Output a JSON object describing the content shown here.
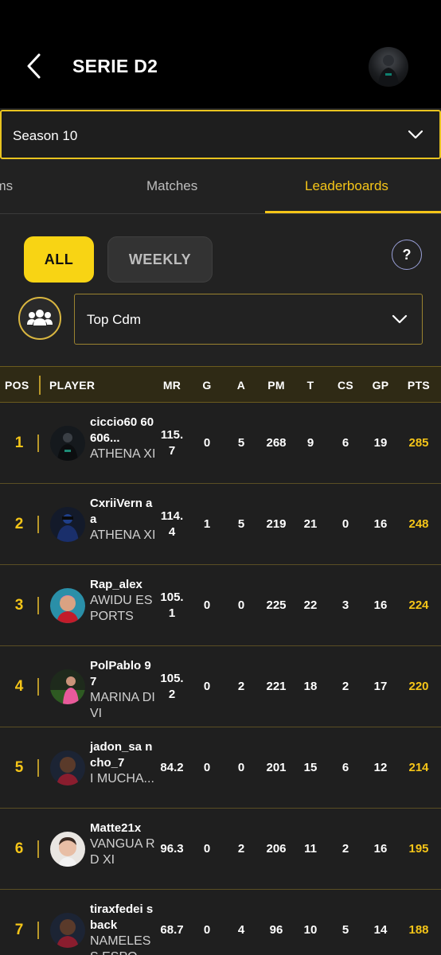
{
  "header": {
    "title": "SERIE D2"
  },
  "season": {
    "label": "Season 10"
  },
  "tabs": [
    {
      "label": "ams"
    },
    {
      "label": "Matches"
    },
    {
      "label": "Leaderboards"
    }
  ],
  "period": {
    "all": "ALL",
    "weekly": "WEEKLY",
    "help": "?"
  },
  "filter": {
    "label": "Top Cdm"
  },
  "table": {
    "headers": {
      "pos": "POS",
      "player": "PLAYER",
      "mr": "MR",
      "g": "G",
      "a": "A",
      "pm": "PM",
      "t": "T",
      "cs": "CS",
      "gp": "GP",
      "pts": "PTS"
    },
    "rows": [
      {
        "pos": "1",
        "name": "ciccio60 60606...",
        "team": "ATHENA XI",
        "mr": "115. 7",
        "g": "0",
        "a": "5",
        "pm": "268",
        "t": "9",
        "cs": "6",
        "gp": "19",
        "pts": "285",
        "avatar": "dark-player"
      },
      {
        "pos": "2",
        "name": "CxriiVern aa",
        "team": "ATHENA XI",
        "mr": "114. 4",
        "g": "1",
        "a": "5",
        "pm": "219",
        "t": "21",
        "cs": "0",
        "gp": "16",
        "pts": "248",
        "avatar": "blue-player"
      },
      {
        "pos": "3",
        "name": "Rap_alex",
        "team": "AWIDU ESPORTS",
        "mr": "105. 1",
        "g": "0",
        "a": "0",
        "pm": "225",
        "t": "22",
        "cs": "3",
        "gp": "16",
        "pts": "224",
        "avatar": "face-player"
      },
      {
        "pos": "4",
        "name": "PolPablo 97",
        "team": "MARINA DIVI",
        "mr": "105. 2",
        "g": "0",
        "a": "2",
        "pm": "221",
        "t": "18",
        "cs": "2",
        "gp": "17",
        "pts": "220",
        "avatar": "pink-player"
      },
      {
        "pos": "5",
        "name": "jadon_sa ncho_7",
        "team": "I MUCHA...",
        "mr": "84.2",
        "g": "0",
        "a": "0",
        "pm": "201",
        "t": "15",
        "cs": "6",
        "gp": "12",
        "pts": "214",
        "avatar": "dark-face"
      },
      {
        "pos": "6",
        "name": "Matte21x",
        "team": "VANGUA RD XI",
        "mr": "96.3",
        "g": "0",
        "a": "2",
        "pm": "206",
        "t": "11",
        "cs": "2",
        "gp": "16",
        "pts": "195",
        "avatar": "light-face"
      },
      {
        "pos": "7",
        "name": "tiraxfedei sback",
        "team": "NAMELES S ESPO...",
        "mr": "68.7",
        "g": "0",
        "a": "4",
        "pm": "96",
        "t": "10",
        "cs": "5",
        "gp": "14",
        "pts": "188",
        "avatar": "dark-face"
      }
    ]
  },
  "colors": {
    "accent": "#f5c518",
    "background": "#222222",
    "header": "#000000"
  }
}
